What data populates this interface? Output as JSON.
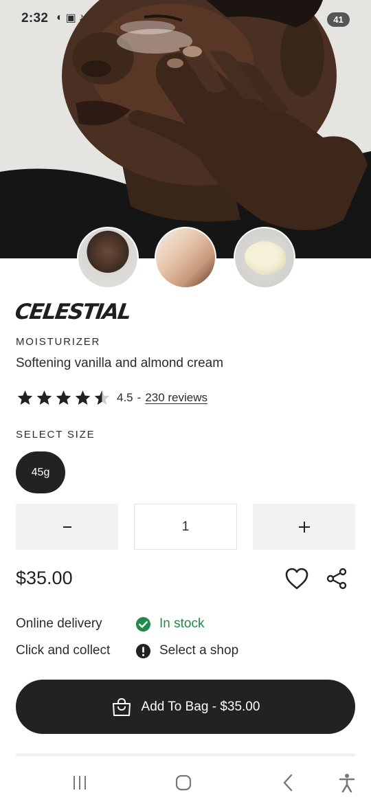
{
  "status_bar": {
    "time": "2:32",
    "icons": [
      "messenger-icon",
      "screenshot-icon",
      "tiktok-icon",
      "more-dots-icon"
    ],
    "battery": "41"
  },
  "product": {
    "name": "CELESTIAL",
    "category": "MOISTURIZER",
    "tagline": "Softening vanilla and almond cream",
    "rating": {
      "value": "4.5",
      "separator": "-",
      "reviews_text": "230 reviews",
      "stars_filled": 4.5,
      "stars_total": 5
    },
    "size_label": "SELECT SIZE",
    "sizes": [
      "45g"
    ],
    "quantity": "1",
    "price": "$35.00",
    "availability": {
      "online_label": "Online delivery",
      "online_status": "In stock",
      "collect_label": "Click and collect",
      "collect_status": "Select a shop"
    },
    "add_to_bag_label": "Add To Bag - $35.00"
  },
  "colors": {
    "primary": "#222222",
    "in_stock": "#1f8a4a",
    "button_gray": "#f2f2f2",
    "background": "#ffffff"
  }
}
